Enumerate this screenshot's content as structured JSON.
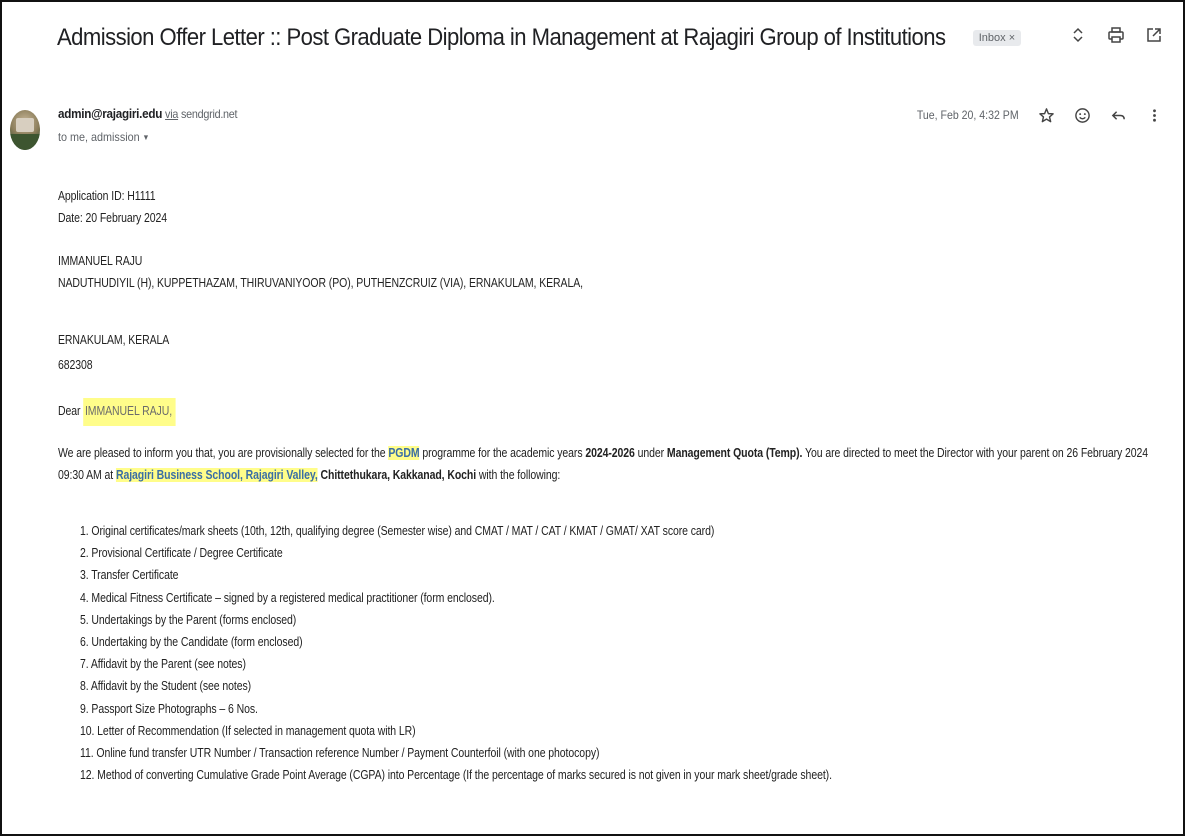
{
  "email": {
    "subject": "Admission Offer Letter :: Post Graduate Diploma in Management at Rajagiri Group of Institutions",
    "label_chip": "Inbox ×",
    "sender_email": "admin@rajagiri.edu",
    "via_text": "via",
    "via_domain": "sendgrid.net",
    "recipients": "to me, admission",
    "timestamp": "Tue, Feb 20, 4:32 PM"
  },
  "icons": {
    "top": [
      "expand-collapse-icon",
      "print-icon",
      "open-in-new-window-icon"
    ],
    "message": [
      "star-icon",
      "emoji-reaction-icon",
      "reply-icon",
      "more-options-icon"
    ]
  },
  "letter": {
    "application_id": "Application ID: H1111",
    "date": "Date: 20 February 2024",
    "recipient_name": "IMMANUEL RAJU",
    "address_line1": "NADUTHUDIYIL (H), KUPPETHAZAM, THIRUVANIYOOR (PO), PUTHENZCRUIZ (VIA), ERNAKULAM, KERALA,",
    "address_line2": "ERNAKULAM, KERALA",
    "pincode": "682308",
    "salutation_prefix": "Dear ",
    "salutation_name": "IMMANUEL RAJU,",
    "para": {
      "p1": "We are pleased to inform you that, you are provisionally selected for the ",
      "programme": "PGDM",
      "p2": " programme for the academic years ",
      "years": "2024-2026",
      "p3": " under ",
      "quota": "Management Quota (Temp).",
      "p4": " You are directed to meet the Director with your parent on 26 February 2024 09:30 AM at ",
      "venue": "Rajagiri Business School, Rajagiri Valley,",
      "p5": " ",
      "location": "Chittethukara, Kakkanad, Kochi",
      "p6": " with the following:"
    },
    "documents": [
      "1. Original certificates/mark sheets (10th, 12th, qualifying degree (Semester wise) and CMAT / MAT / CAT / KMAT / GMAT/ XAT score card)",
      "2. Provisional Certificate / Degree Certificate",
      "3. Transfer Certificate",
      "4. Medical Fitness Certificate – signed by a registered medical practitioner (form enclosed).",
      "5. Undertakings by the Parent (forms enclosed)",
      "6. Undertaking by the Candidate (form enclosed)",
      "7. Affidavit by the Parent (see notes)",
      "8. Affidavit by the Student (see notes)",
      "9. Passport Size Photographs – 6 Nos.",
      "10. Letter of Recommendation (If selected in management quota with LR)",
      "11. Online fund transfer UTR Number / Transaction reference Number / Payment Counterfoil (with one photocopy)",
      "12. Method of converting Cumulative Grade Point Average (CGPA) into Percentage (If the percentage of marks secured is not given in your mark sheet/grade sheet)."
    ]
  },
  "colors": {
    "highlight": "#fffd8a",
    "text": "#222222",
    "muted": "#5f6368"
  }
}
